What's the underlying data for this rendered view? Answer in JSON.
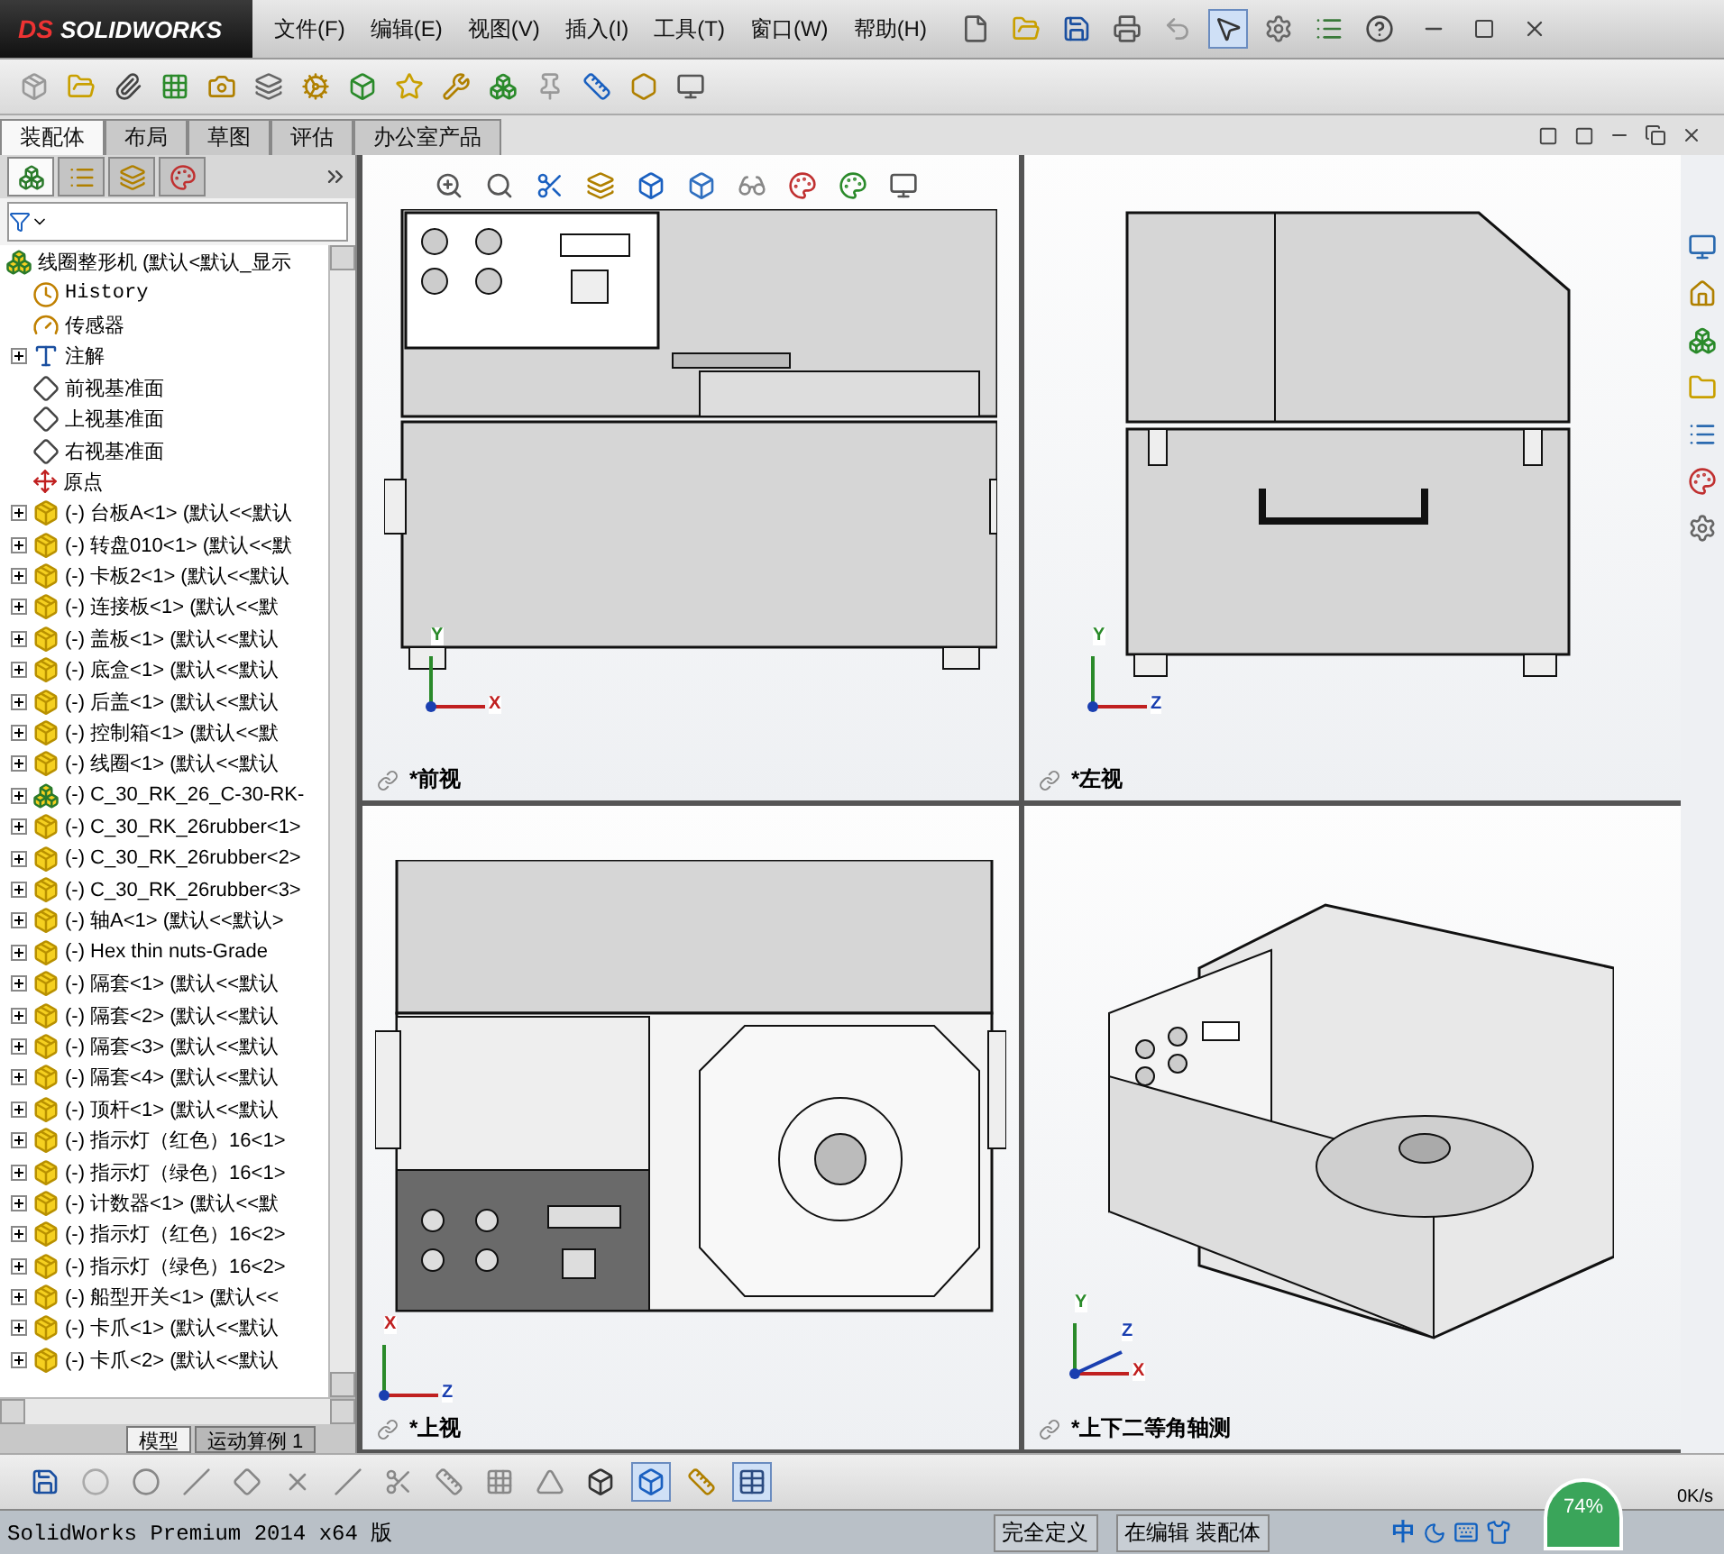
{
  "logo": {
    "mark": "DS",
    "text": "SOLIDWORKS"
  },
  "menu": [
    "文件(F)",
    "编辑(E)",
    "视图(V)",
    "插入(I)",
    "工具(T)",
    "窗口(W)",
    "帮助(H)"
  ],
  "command_tabs": [
    {
      "label": "装配体",
      "selected": true
    },
    {
      "label": "布局",
      "selected": false
    },
    {
      "label": "草图",
      "selected": false
    },
    {
      "label": "评估",
      "selected": false
    },
    {
      "label": "办公室产品",
      "selected": false
    }
  ],
  "tree": {
    "root": "线圈整形机  (默认<默认_显示",
    "items": [
      {
        "kind": "history",
        "label": "History",
        "expandable": false
      },
      {
        "kind": "sensor",
        "label": "传感器",
        "expandable": false
      },
      {
        "kind": "annotation",
        "label": "注解",
        "expandable": true
      },
      {
        "kind": "plane",
        "label": "前视基准面",
        "expandable": false
      },
      {
        "kind": "plane",
        "label": "上视基准面",
        "expandable": false
      },
      {
        "kind": "plane",
        "label": "右视基准面",
        "expandable": false
      },
      {
        "kind": "origin",
        "label": "原点",
        "expandable": false
      },
      {
        "kind": "part",
        "label": "(-) 台板A<1> (默认<<默认",
        "expandable": true
      },
      {
        "kind": "part",
        "label": "(-) 转盘010<1> (默认<<默",
        "expandable": true
      },
      {
        "kind": "part",
        "label": "(-) 卡板2<1> (默认<<默认",
        "expandable": true
      },
      {
        "kind": "part",
        "label": "(-) 连接板<1> (默认<<默",
        "expandable": true
      },
      {
        "kind": "part",
        "label": "(-) 盖板<1> (默认<<默认",
        "expandable": true
      },
      {
        "kind": "part",
        "label": "(-) 底盒<1> (默认<<默认",
        "expandable": true
      },
      {
        "kind": "part",
        "label": "(-) 后盖<1> (默认<<默认",
        "expandable": true
      },
      {
        "kind": "part",
        "label": "(-) 控制箱<1> (默认<<默",
        "expandable": true
      },
      {
        "kind": "part",
        "label": "(-) 线圈<1> (默认<<默认",
        "expandable": true
      },
      {
        "kind": "assembly",
        "label": "(-) C_30_RK_26_C-30-RK-",
        "expandable": true
      },
      {
        "kind": "part",
        "label": "(-) C_30_RK_26rubber<1>",
        "expandable": true
      },
      {
        "kind": "part",
        "label": "(-) C_30_RK_26rubber<2>",
        "expandable": true
      },
      {
        "kind": "part",
        "label": "(-) C_30_RK_26rubber<3>",
        "expandable": true
      },
      {
        "kind": "part",
        "label": "(-) 轴A<1> (默认<<默认>",
        "expandable": true
      },
      {
        "kind": "part",
        "label": "(-) Hex thin nuts-Grade",
        "expandable": true
      },
      {
        "kind": "part",
        "label": "(-) 隔套<1> (默认<<默认",
        "expandable": true
      },
      {
        "kind": "part",
        "label": "(-) 隔套<2> (默认<<默认",
        "expandable": true
      },
      {
        "kind": "part",
        "label": "(-) 隔套<3> (默认<<默认",
        "expandable": true
      },
      {
        "kind": "part",
        "label": "(-) 隔套<4> (默认<<默认",
        "expandable": true
      },
      {
        "kind": "part",
        "label": "(-) 顶杆<1> (默认<<默认",
        "expandable": true
      },
      {
        "kind": "part",
        "label": "(-) 指示灯（红色）16<1>",
        "expandable": true
      },
      {
        "kind": "part",
        "label": "(-) 指示灯（绿色）16<1>",
        "expandable": true
      },
      {
        "kind": "part",
        "label": "(-) 计数器<1> (默认<<默",
        "expandable": true
      },
      {
        "kind": "part",
        "label": "(-) 指示灯（红色）16<2>",
        "expandable": true
      },
      {
        "kind": "part",
        "label": "(-) 指示灯（绿色）16<2>",
        "expandable": true
      },
      {
        "kind": "part",
        "label": "(-) 船型开关<1> (默认<<",
        "expandable": true
      },
      {
        "kind": "part",
        "label": "(-) 卡爪<1> (默认<<默认",
        "expandable": true
      },
      {
        "kind": "part",
        "label": "(-) 卡爪<2> (默认<<默认",
        "expandable": true
      }
    ]
  },
  "bottom_tabs": [
    {
      "label": "模型",
      "selected": true
    },
    {
      "label": "运动算例 1",
      "selected": false
    }
  ],
  "viewports": [
    {
      "kind": "front",
      "label": "*前视",
      "axes": [
        "Y",
        "X"
      ]
    },
    {
      "kind": "left",
      "label": "*左视",
      "axes": [
        "Y",
        "Z"
      ]
    },
    {
      "kind": "top",
      "label": "*上视",
      "axes": [
        "X",
        "Z"
      ]
    },
    {
      "kind": "iso",
      "label": "*上下二等角轴测",
      "axes": [
        "Y",
        "Z",
        "X"
      ]
    }
  ],
  "status_bar": {
    "product": "SolidWorks Premium 2014 x64 版",
    "fields": [
      "完全定义",
      "在编辑 装配体"
    ],
    "gauge": "74%",
    "speed": "0K/s",
    "ime": "中"
  }
}
